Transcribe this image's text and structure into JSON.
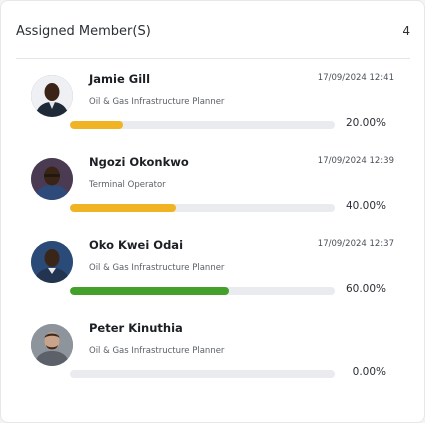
{
  "card": {
    "title": "Assigned Member(S)",
    "count": "4"
  },
  "colors": {
    "progress_low": "#f0b323",
    "progress_high": "#43a02a",
    "track": "#e9ebef"
  },
  "members": [
    {
      "name": "Jamie Gill",
      "role": "Oil & Gas Infrastructure Planner",
      "timestamp": "17/09/2024 12:41",
      "progress": 0.2,
      "progress_label": "20.00%",
      "progress_color": "#f0b323",
      "avatar_icon": "person-avatar"
    },
    {
      "name": "Ngozi Okonkwo",
      "role": "Terminal Operator",
      "timestamp": "17/09/2024 12:39",
      "progress": 0.4,
      "progress_label": "40.00%",
      "progress_color": "#f0b323",
      "avatar_icon": "person-avatar"
    },
    {
      "name": "Oko Kwei Odai",
      "role": "Oil & Gas Infrastructure Planner",
      "timestamp": "17/09/2024 12:37",
      "progress": 0.6,
      "progress_label": "60.00%",
      "progress_color": "#43a02a",
      "avatar_icon": "person-avatar"
    },
    {
      "name": "Peter Kinuthia",
      "role": "Oil & Gas Infrastructure Planner",
      "timestamp": "",
      "progress": 0,
      "progress_label": "0.00%",
      "progress_color": "#43a02a",
      "avatar_icon": "person-avatar"
    }
  ]
}
